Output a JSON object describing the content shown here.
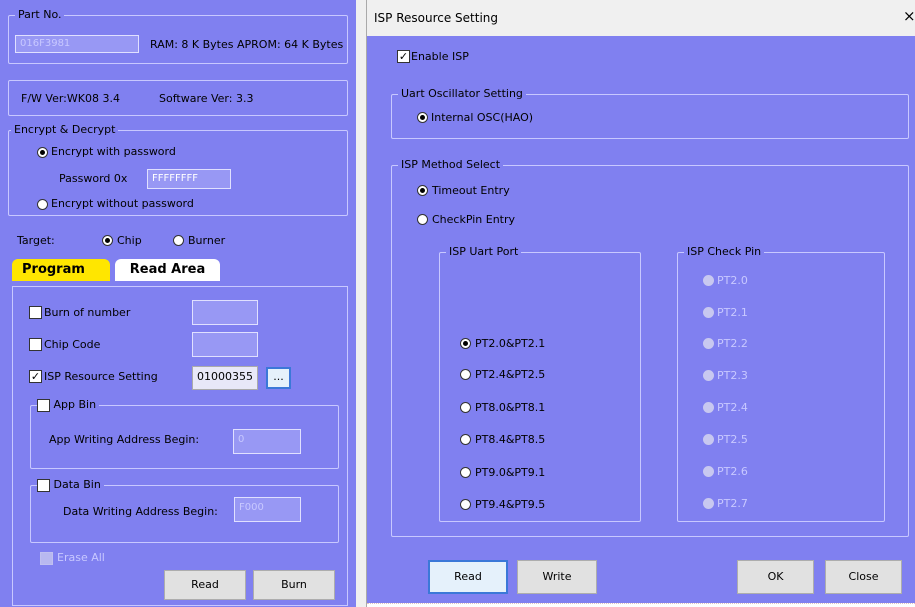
{
  "left": {
    "part_no": {
      "legend": "Part No.",
      "value": "016F3981",
      "ram": "RAM: 8 K Bytes",
      "aprom": "APROM: 64 K Bytes"
    },
    "versions": {
      "fw": "F/W Ver:WK08 3.4",
      "sw": "Software Ver: 3.3"
    },
    "encrypt": {
      "legend": "Encrypt & Decrypt",
      "with_pw": "Encrypt with password",
      "pw_label": "Password 0x",
      "pw_value": "FFFFFFFF",
      "without_pw": "Encrypt without password"
    },
    "target": {
      "label": "Target:",
      "chip": "Chip",
      "burner": "Burner"
    },
    "tabs": {
      "program": "Program",
      "read_area": "Read Area"
    },
    "burn_of_number": "Burn of number",
    "chip_code": "Chip Code",
    "isp_setting": {
      "label": "ISP Resource Setting",
      "value": "01000355",
      "dots": "..."
    },
    "app_bin": {
      "legend": "App Bin",
      "label": "App Writing Address Begin:",
      "value": "0"
    },
    "data_bin": {
      "legend": "Data Bin",
      "label": "Data Writing Address Begin:",
      "value": "F000"
    },
    "erase_all": "Erase All",
    "read_btn": "Read",
    "burn_btn": "Burn"
  },
  "dialog": {
    "title": "ISP Resource Setting",
    "close": "×",
    "enable_isp": "Enable ISP",
    "osc": {
      "legend": "Uart Oscillator Setting",
      "option": "Internal OSC(HAO)"
    },
    "method": {
      "legend": "ISP Method Select",
      "timeout": "Timeout Entry",
      "checkpin": "CheckPin Entry"
    },
    "uart_port": {
      "legend": "ISP Uart Port",
      "options": [
        "PT2.0&PT2.1",
        "PT2.4&PT2.5",
        "PT8.0&PT8.1",
        "PT8.4&PT8.5",
        "PT9.0&PT9.1",
        "PT9.4&PT9.5"
      ]
    },
    "check_pin": {
      "legend": "ISP Check Pin",
      "options": [
        "PT2.0",
        "PT2.1",
        "PT2.2",
        "PT2.3",
        "PT2.4",
        "PT2.5",
        "PT2.6",
        "PT2.7"
      ]
    },
    "buttons": {
      "read": "Read",
      "write": "Write",
      "ok": "OK",
      "close": "Close"
    }
  }
}
